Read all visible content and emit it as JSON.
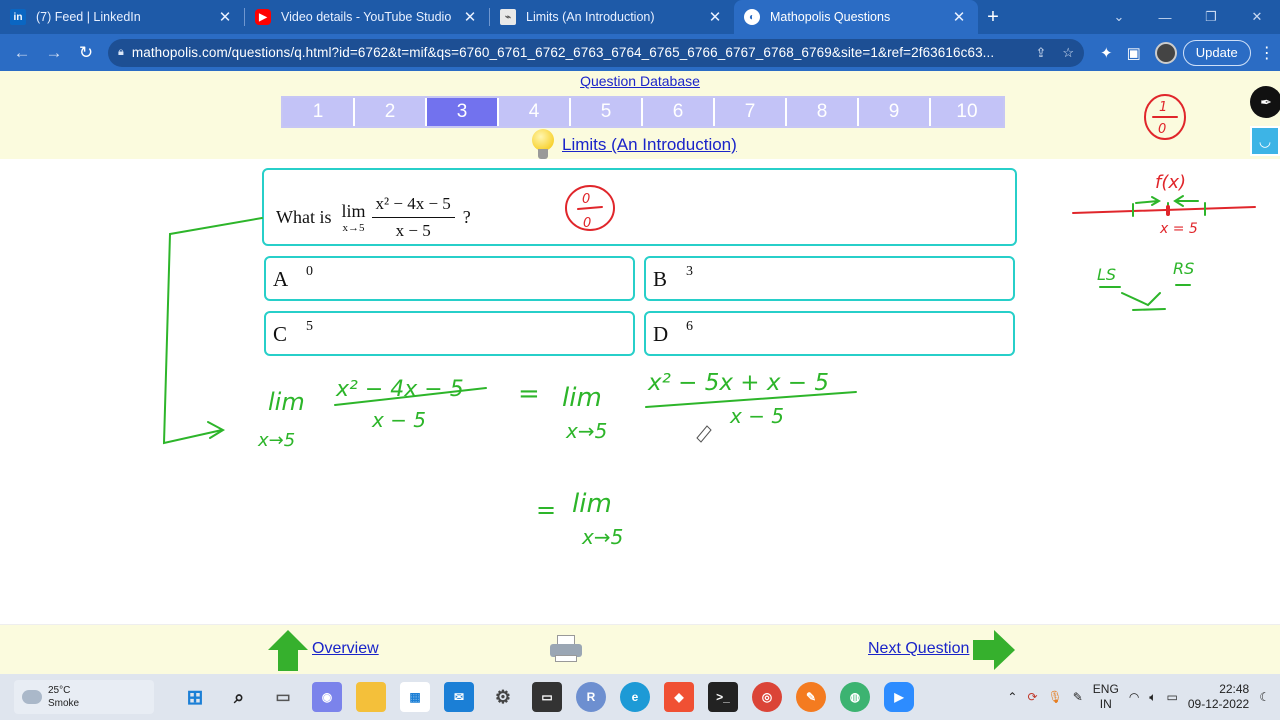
{
  "browser": {
    "tabs": [
      {
        "title": "(7) Feed | LinkedIn",
        "icon": "linkedin-icon",
        "active": false
      },
      {
        "title": "Video details - YouTube Studio",
        "icon": "youtube-icon",
        "active": false
      },
      {
        "title": "Limits (An Introduction)",
        "icon": "page-icon",
        "active": false
      },
      {
        "title": "Mathopolis Questions",
        "icon": "mathopolis-icon",
        "active": true
      }
    ],
    "new_tab": "+",
    "url": "mathopolis.com/questions/q.html?id=6762&t=mif&qs=6760_6761_6762_6763_6764_6765_6766_6767_6768_6769&site=1&ref=2f63616c63...",
    "update_label": "Update"
  },
  "page": {
    "question_database": "Question Database",
    "question_numbers": [
      "1",
      "2",
      "3",
      "4",
      "5",
      "6",
      "7",
      "8",
      "9",
      "10"
    ],
    "selected_question": "3",
    "topic": "Limits (An Introduction)",
    "question": {
      "prefix": "What is",
      "lim": "lim",
      "lim_sub": "x→5",
      "numerator": "x² − 4x − 5",
      "denominator": "x − 5",
      "suffix": "?"
    },
    "answers": [
      {
        "letter": "A",
        "value": "0"
      },
      {
        "letter": "B",
        "value": "3"
      },
      {
        "letter": "C",
        "value": "5"
      },
      {
        "letter": "D",
        "value": "6"
      }
    ],
    "overview": "Overview",
    "next_question": "Next Question"
  },
  "ink": {
    "color": "#2db52a",
    "red": "#e0262b",
    "zero_over_zero": "0/0",
    "fx_label": "f(x)",
    "x_eq_5": "x = 5",
    "ls": "LS",
    "rs": "RS",
    "step1_lim": "lim",
    "step1_sub": "x→5",
    "step1_num": "x² − 4x − 5",
    "step1_den": "x − 5",
    "step2_eq": "=",
    "step2_lim": "lim",
    "step2_sub": "x→5",
    "step2_num": "x² − 5x + x − 5",
    "step2_den": "x − 5",
    "step3_eq": "=",
    "step3_lim": "lim",
    "step3_sub": "x→5",
    "indeterminate_top": "1",
    "indeterminate_bottom": "0"
  },
  "taskbar": {
    "temp": "25°C",
    "weather": "Smoke",
    "lang_top": "ENG",
    "lang_bottom": "IN",
    "time": "22:48",
    "date": "09-12-2022"
  }
}
